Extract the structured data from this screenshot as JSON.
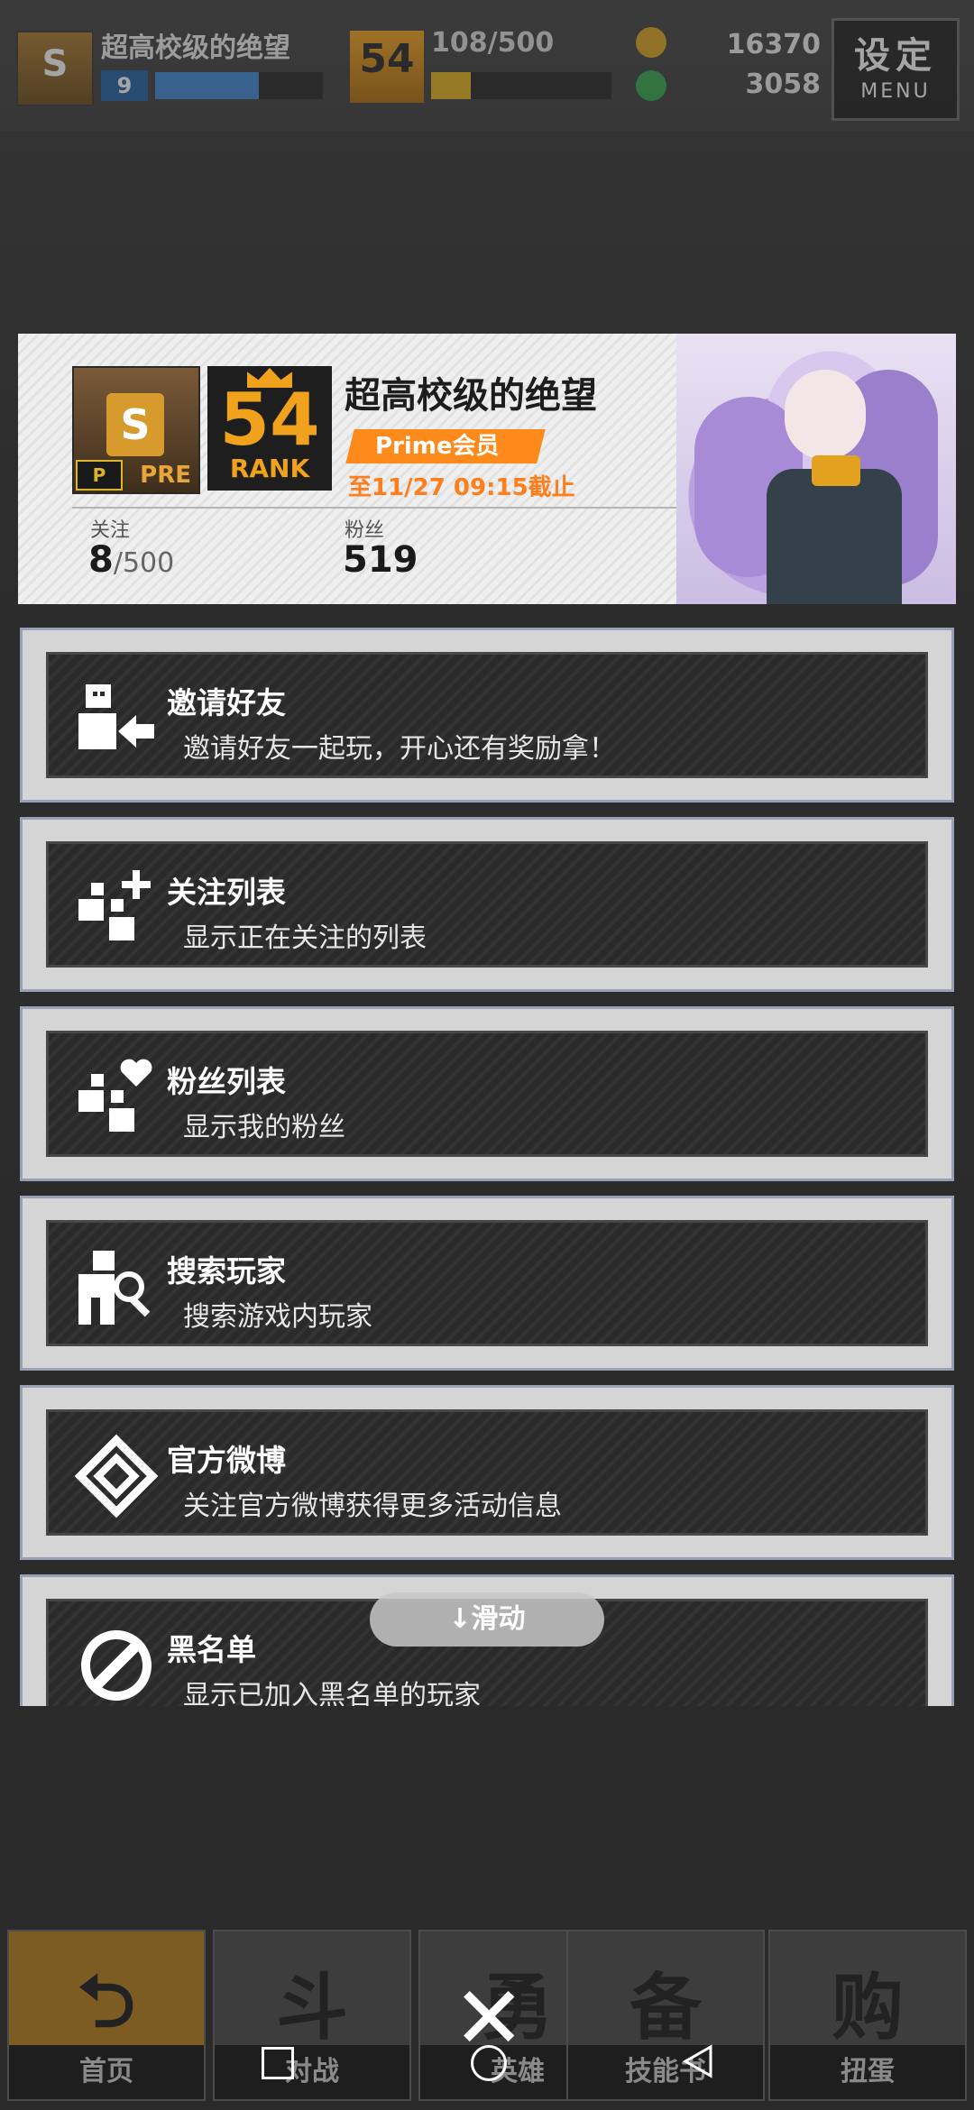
{
  "hud": {
    "player_name": "超高校级的绝望",
    "level_badge": "S",
    "level": "9",
    "rank_badge": "54",
    "rank_progress": "108/500",
    "gold": "16370",
    "gems": "3058",
    "menu_cn": "设定",
    "menu_en": "MENU"
  },
  "profile": {
    "badge_letter": "S",
    "badge_sub": "PRE",
    "badge_mark": "P",
    "rank_number": "54",
    "rank_label": "RANK",
    "name": "超高校级的绝望",
    "prime_tag": "Prime会员",
    "expiry": "至11/27 09:15截止",
    "follow_label": "关注",
    "follow_count": "8",
    "follow_max": "/500",
    "fans_label": "粉丝",
    "fans_count": "519"
  },
  "menu": [
    {
      "title": "邀请好友",
      "desc": "邀请好友一起玩，开心还有奖励拿！",
      "icon": "invite-friend-icon"
    },
    {
      "title": "关注列表",
      "desc": "显示正在关注的列表",
      "icon": "follow-list-icon"
    },
    {
      "title": "粉丝列表",
      "desc": "显示我的粉丝",
      "icon": "fans-list-icon"
    },
    {
      "title": "搜索玩家",
      "desc": "搜索游戏内玩家",
      "icon": "search-player-icon"
    },
    {
      "title": "官方微博",
      "desc": "关注官方微博获得更多活动信息",
      "icon": "weibo-icon"
    },
    {
      "title": "黑名单",
      "desc": "显示已加入黑名单的玩家",
      "icon": "blacklist-icon"
    }
  ],
  "scroll_hint": "↓滑动",
  "bottom_nav": [
    {
      "label": "首页",
      "glyph": "⮌"
    },
    {
      "label": "对战",
      "glyph": "斗"
    },
    {
      "label": "英雄",
      "glyph": "勇"
    },
    {
      "label": "技能书",
      "glyph": "备"
    },
    {
      "label": "扭蛋",
      "glyph": "购"
    }
  ],
  "close_symbol": "✕"
}
